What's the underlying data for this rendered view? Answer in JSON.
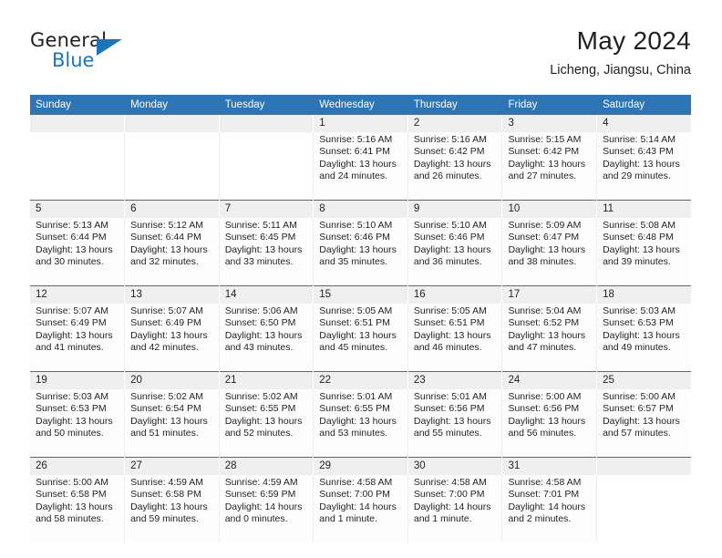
{
  "brand": {
    "name_part1": "General",
    "name_part2": "Blue",
    "accent_color": "#1b75bb"
  },
  "header": {
    "title": "May 2024",
    "location": "Licheng, Jiangsu, China",
    "header_bar_color": "#2e75b6"
  },
  "weekdays": [
    "Sunday",
    "Monday",
    "Tuesday",
    "Wednesday",
    "Thursday",
    "Friday",
    "Saturday"
  ],
  "weeks": [
    [
      {
        "day": "",
        "sunrise": "",
        "sunset": "",
        "daylight_1": "",
        "daylight_2": ""
      },
      {
        "day": "",
        "sunrise": "",
        "sunset": "",
        "daylight_1": "",
        "daylight_2": ""
      },
      {
        "day": "",
        "sunrise": "",
        "sunset": "",
        "daylight_1": "",
        "daylight_2": ""
      },
      {
        "day": "1",
        "sunrise": "Sunrise: 5:16 AM",
        "sunset": "Sunset: 6:41 PM",
        "daylight_1": "Daylight: 13 hours",
        "daylight_2": "and 24 minutes."
      },
      {
        "day": "2",
        "sunrise": "Sunrise: 5:16 AM",
        "sunset": "Sunset: 6:42 PM",
        "daylight_1": "Daylight: 13 hours",
        "daylight_2": "and 26 minutes."
      },
      {
        "day": "3",
        "sunrise": "Sunrise: 5:15 AM",
        "sunset": "Sunset: 6:42 PM",
        "daylight_1": "Daylight: 13 hours",
        "daylight_2": "and 27 minutes."
      },
      {
        "day": "4",
        "sunrise": "Sunrise: 5:14 AM",
        "sunset": "Sunset: 6:43 PM",
        "daylight_1": "Daylight: 13 hours",
        "daylight_2": "and 29 minutes."
      }
    ],
    [
      {
        "day": "5",
        "sunrise": "Sunrise: 5:13 AM",
        "sunset": "Sunset: 6:44 PM",
        "daylight_1": "Daylight: 13 hours",
        "daylight_2": "and 30 minutes."
      },
      {
        "day": "6",
        "sunrise": "Sunrise: 5:12 AM",
        "sunset": "Sunset: 6:44 PM",
        "daylight_1": "Daylight: 13 hours",
        "daylight_2": "and 32 minutes."
      },
      {
        "day": "7",
        "sunrise": "Sunrise: 5:11 AM",
        "sunset": "Sunset: 6:45 PM",
        "daylight_1": "Daylight: 13 hours",
        "daylight_2": "and 33 minutes."
      },
      {
        "day": "8",
        "sunrise": "Sunrise: 5:10 AM",
        "sunset": "Sunset: 6:46 PM",
        "daylight_1": "Daylight: 13 hours",
        "daylight_2": "and 35 minutes."
      },
      {
        "day": "9",
        "sunrise": "Sunrise: 5:10 AM",
        "sunset": "Sunset: 6:46 PM",
        "daylight_1": "Daylight: 13 hours",
        "daylight_2": "and 36 minutes."
      },
      {
        "day": "10",
        "sunrise": "Sunrise: 5:09 AM",
        "sunset": "Sunset: 6:47 PM",
        "daylight_1": "Daylight: 13 hours",
        "daylight_2": "and 38 minutes."
      },
      {
        "day": "11",
        "sunrise": "Sunrise: 5:08 AM",
        "sunset": "Sunset: 6:48 PM",
        "daylight_1": "Daylight: 13 hours",
        "daylight_2": "and 39 minutes."
      }
    ],
    [
      {
        "day": "12",
        "sunrise": "Sunrise: 5:07 AM",
        "sunset": "Sunset: 6:49 PM",
        "daylight_1": "Daylight: 13 hours",
        "daylight_2": "and 41 minutes."
      },
      {
        "day": "13",
        "sunrise": "Sunrise: 5:07 AM",
        "sunset": "Sunset: 6:49 PM",
        "daylight_1": "Daylight: 13 hours",
        "daylight_2": "and 42 minutes."
      },
      {
        "day": "14",
        "sunrise": "Sunrise: 5:06 AM",
        "sunset": "Sunset: 6:50 PM",
        "daylight_1": "Daylight: 13 hours",
        "daylight_2": "and 43 minutes."
      },
      {
        "day": "15",
        "sunrise": "Sunrise: 5:05 AM",
        "sunset": "Sunset: 6:51 PM",
        "daylight_1": "Daylight: 13 hours",
        "daylight_2": "and 45 minutes."
      },
      {
        "day": "16",
        "sunrise": "Sunrise: 5:05 AM",
        "sunset": "Sunset: 6:51 PM",
        "daylight_1": "Daylight: 13 hours",
        "daylight_2": "and 46 minutes."
      },
      {
        "day": "17",
        "sunrise": "Sunrise: 5:04 AM",
        "sunset": "Sunset: 6:52 PM",
        "daylight_1": "Daylight: 13 hours",
        "daylight_2": "and 47 minutes."
      },
      {
        "day": "18",
        "sunrise": "Sunrise: 5:03 AM",
        "sunset": "Sunset: 6:53 PM",
        "daylight_1": "Daylight: 13 hours",
        "daylight_2": "and 49 minutes."
      }
    ],
    [
      {
        "day": "19",
        "sunrise": "Sunrise: 5:03 AM",
        "sunset": "Sunset: 6:53 PM",
        "daylight_1": "Daylight: 13 hours",
        "daylight_2": "and 50 minutes."
      },
      {
        "day": "20",
        "sunrise": "Sunrise: 5:02 AM",
        "sunset": "Sunset: 6:54 PM",
        "daylight_1": "Daylight: 13 hours",
        "daylight_2": "and 51 minutes."
      },
      {
        "day": "21",
        "sunrise": "Sunrise: 5:02 AM",
        "sunset": "Sunset: 6:55 PM",
        "daylight_1": "Daylight: 13 hours",
        "daylight_2": "and 52 minutes."
      },
      {
        "day": "22",
        "sunrise": "Sunrise: 5:01 AM",
        "sunset": "Sunset: 6:55 PM",
        "daylight_1": "Daylight: 13 hours",
        "daylight_2": "and 53 minutes."
      },
      {
        "day": "23",
        "sunrise": "Sunrise: 5:01 AM",
        "sunset": "Sunset: 6:56 PM",
        "daylight_1": "Daylight: 13 hours",
        "daylight_2": "and 55 minutes."
      },
      {
        "day": "24",
        "sunrise": "Sunrise: 5:00 AM",
        "sunset": "Sunset: 6:56 PM",
        "daylight_1": "Daylight: 13 hours",
        "daylight_2": "and 56 minutes."
      },
      {
        "day": "25",
        "sunrise": "Sunrise: 5:00 AM",
        "sunset": "Sunset: 6:57 PM",
        "daylight_1": "Daylight: 13 hours",
        "daylight_2": "and 57 minutes."
      }
    ],
    [
      {
        "day": "26",
        "sunrise": "Sunrise: 5:00 AM",
        "sunset": "Sunset: 6:58 PM",
        "daylight_1": "Daylight: 13 hours",
        "daylight_2": "and 58 minutes."
      },
      {
        "day": "27",
        "sunrise": "Sunrise: 4:59 AM",
        "sunset": "Sunset: 6:58 PM",
        "daylight_1": "Daylight: 13 hours",
        "daylight_2": "and 59 minutes."
      },
      {
        "day": "28",
        "sunrise": "Sunrise: 4:59 AM",
        "sunset": "Sunset: 6:59 PM",
        "daylight_1": "Daylight: 14 hours",
        "daylight_2": "and 0 minutes."
      },
      {
        "day": "29",
        "sunrise": "Sunrise: 4:58 AM",
        "sunset": "Sunset: 7:00 PM",
        "daylight_1": "Daylight: 14 hours",
        "daylight_2": "and 1 minute."
      },
      {
        "day": "30",
        "sunrise": "Sunrise: 4:58 AM",
        "sunset": "Sunset: 7:00 PM",
        "daylight_1": "Daylight: 14 hours",
        "daylight_2": "and 1 minute."
      },
      {
        "day": "31",
        "sunrise": "Sunrise: 4:58 AM",
        "sunset": "Sunset: 7:01 PM",
        "daylight_1": "Daylight: 14 hours",
        "daylight_2": "and 2 minutes."
      },
      {
        "day": "",
        "sunrise": "",
        "sunset": "",
        "daylight_1": "",
        "daylight_2": ""
      }
    ]
  ]
}
